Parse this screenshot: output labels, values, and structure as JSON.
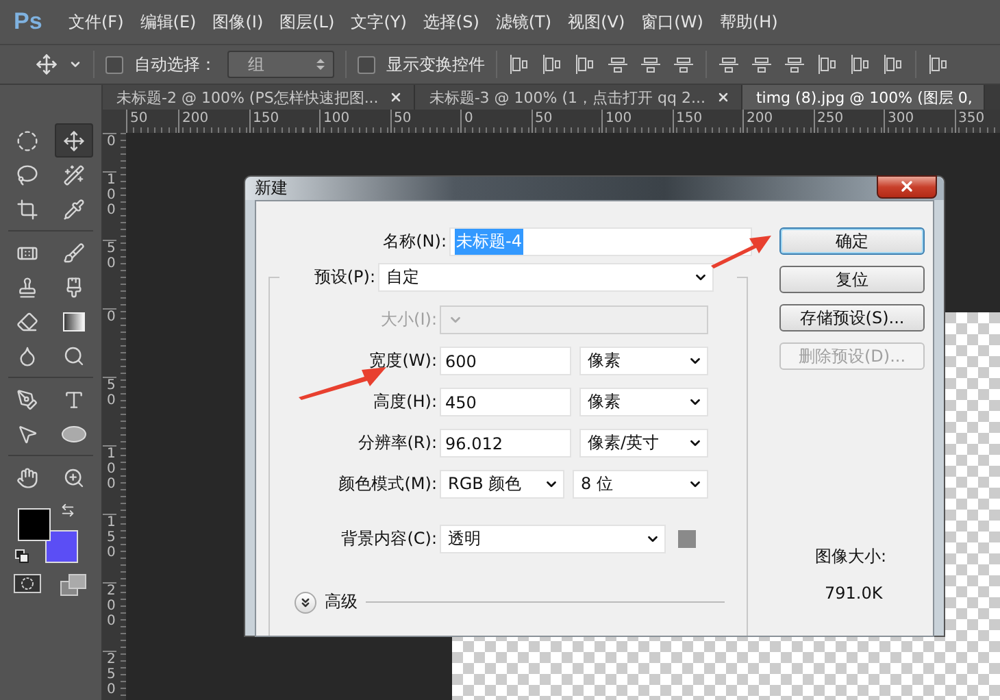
{
  "menu_bar": {
    "logo": "Ps",
    "items": [
      "文件(F)",
      "编辑(E)",
      "图像(I)",
      "图层(L)",
      "文字(Y)",
      "选择(S)",
      "滤镜(T)",
      "视图(V)",
      "窗口(W)",
      "帮助(H)"
    ]
  },
  "options_bar": {
    "auto_select": {
      "label": "自动选择：",
      "checked": false
    },
    "auto_select_target": "组",
    "show_transform": {
      "label": "显示变换控件",
      "checked": false
    }
  },
  "tabs": [
    {
      "title": "未标题-2 @ 100% (PS怎样快速把图...",
      "closable": true,
      "selected": false
    },
    {
      "title": "未标题-3 @ 100% (1，点击打开 qq 2...",
      "closable": true,
      "selected": false
    },
    {
      "title": "timg (8).jpg @ 100% (图层 0,",
      "closable": false,
      "selected": true
    }
  ],
  "rulers": {
    "horizontal": [
      "50",
      "200",
      "150",
      "100",
      "50",
      "0",
      "50",
      "100",
      "150",
      "200",
      "250",
      "300",
      "350"
    ],
    "vertical": [
      "0",
      "100",
      "50",
      "0",
      "50",
      "100",
      "150",
      "200",
      "250"
    ]
  },
  "tools": [
    {
      "kind": "marquee",
      "selected": false
    },
    {
      "kind": "move",
      "selected": true
    },
    {
      "kind": "lasso",
      "selected": false
    },
    {
      "kind": "wand",
      "selected": false
    },
    {
      "kind": "crop",
      "selected": false
    },
    {
      "kind": "eyedropper",
      "selected": false
    },
    {
      "kind": "healing",
      "selected": false
    },
    {
      "kind": "brush",
      "selected": false
    },
    {
      "kind": "stamp",
      "selected": false
    },
    {
      "kind": "history_brush",
      "selected": false
    },
    {
      "kind": "eraser",
      "selected": false
    },
    {
      "kind": "gradient",
      "selected": false
    },
    {
      "kind": "blur",
      "selected": false
    },
    {
      "kind": "dodge",
      "selected": false
    },
    {
      "kind": "pen",
      "selected": false
    },
    {
      "kind": "type",
      "selected": false
    },
    {
      "kind": "path_select",
      "selected": false
    },
    {
      "kind": "shape",
      "selected": false
    },
    {
      "kind": "hand",
      "selected": false
    },
    {
      "kind": "zoom",
      "selected": false
    }
  ],
  "color_swatches": [
    {
      "kind": "foreground",
      "color": "#000000"
    },
    {
      "kind": "background",
      "color": "#5b4ef5"
    }
  ],
  "dialog": {
    "title": "新建",
    "name": {
      "label": "名称(N):",
      "value": "未标题-4",
      "selected": true
    },
    "preset": {
      "label": "预设(P):",
      "value": "自定"
    },
    "size": {
      "label": "大小(I):",
      "disabled": true
    },
    "width": {
      "label": "宽度(W):",
      "value": "600",
      "unit": "像素"
    },
    "height": {
      "label": "高度(H):",
      "value": "450",
      "unit": "像素"
    },
    "resolution": {
      "label": "分辨率(R):",
      "value": "96.012",
      "unit": "像素/英寸"
    },
    "color_mode": {
      "label": "颜色模式(M):",
      "value": "RGB 颜色",
      "bits": "8 位"
    },
    "background": {
      "label": "背景内容(C):",
      "value": "透明",
      "color": "#8a8a8a"
    },
    "advanced": {
      "label": "高级",
      "expanded": false
    },
    "buttons": [
      {
        "label": "确定",
        "default": true,
        "disabled": false
      },
      {
        "label": "复位",
        "default": false,
        "disabled": false
      },
      {
        "label": "存储预设(S)...",
        "default": false,
        "disabled": false
      },
      {
        "label": "删除预设(D)...",
        "default": false,
        "disabled": true
      }
    ],
    "image_size": {
      "label": "图像大小:",
      "value": "791.0K"
    }
  }
}
